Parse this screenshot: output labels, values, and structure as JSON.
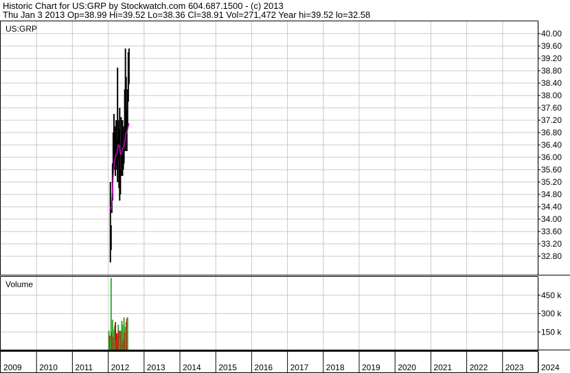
{
  "header": {
    "title": "Historic Chart for US:GRP by Stockwatch.com 604.687.1500 - (c) 2013",
    "quote": "Thu Jan  3 2013  Op=38.99  Hi=39.52  Lo=38.36  Cl=38.91  Vol=271,472  Year hi=39.52  lo=32.58"
  },
  "chart_data": [
    {
      "type": "candlestick",
      "title": "US:GRP",
      "price_ticks": [
        "40.00",
        "39.60",
        "39.20",
        "38.80",
        "38.40",
        "38.00",
        "37.60",
        "37.20",
        "36.80",
        "36.40",
        "36.00",
        "35.60",
        "35.20",
        "34.80",
        "34.40",
        "34.00",
        "33.60",
        "33.20",
        "32.80"
      ],
      "ylim": [
        32.2,
        40.4
      ],
      "x_ticks": [
        "2009",
        "2010",
        "2011",
        "2012",
        "2013",
        "2014",
        "2015",
        "2016",
        "2017",
        "2018",
        "2019",
        "2020",
        "2021",
        "2022",
        "2023",
        "2024"
      ],
      "grid": true,
      "moving_average_color": "#cc00cc",
      "bar_color": "#000000",
      "x": [
        2012.06,
        2012.08,
        2012.1,
        2012.12,
        2012.14,
        2012.16,
        2012.18,
        2012.2,
        2012.22,
        2012.24,
        2012.26,
        2012.28,
        2012.3,
        2012.32,
        2012.34,
        2012.36,
        2012.38,
        2012.4,
        2012.42,
        2012.44,
        2012.46,
        2012.48,
        2012.5,
        2012.52,
        2012.54,
        2012.56,
        2012.58
      ],
      "high": [
        35.2,
        33.8,
        34.6,
        35.8,
        36.8,
        37.4,
        37.0,
        36.8,
        37.2,
        36.6,
        38.9,
        37.2,
        36.9,
        37.6,
        35.6,
        37.3,
        36.8,
        37.2,
        36.4,
        37.0,
        38.2,
        39.52,
        38.6,
        37.5,
        38.2,
        39.4,
        39.52
      ],
      "low": [
        32.6,
        33.0,
        34.2,
        34.6,
        35.6,
        35.8,
        35.6,
        35.4,
        35.8,
        35.6,
        35.2,
        35.9,
        35.0,
        34.6,
        34.8,
        35.4,
        35.8,
        35.4,
        35.6,
        35.8,
        36.4,
        36.2,
        36.6,
        36.2,
        37.0,
        37.8,
        38.36
      ],
      "ma": [
        34.4,
        34.3,
        34.6,
        35.0,
        35.4,
        35.7,
        35.9,
        36.0,
        36.1,
        36.1,
        36.3,
        36.4,
        36.4,
        36.3,
        36.1,
        36.1,
        36.2,
        36.3,
        36.3,
        36.4,
        36.5,
        36.7,
        36.8,
        36.8,
        36.9,
        37.0,
        37.1
      ]
    },
    {
      "type": "bar",
      "title": "Volume",
      "volume_ticks": [
        "450 k",
        "300 k",
        "150 k"
      ],
      "ylim": [
        0,
        600
      ],
      "up_color": "#33aa33",
      "down_color": "#dd0000",
      "x": [
        2012.02,
        2012.04,
        2012.06,
        2012.08,
        2012.1,
        2012.12,
        2012.14,
        2012.16,
        2012.18,
        2012.2,
        2012.22,
        2012.24,
        2012.26,
        2012.28,
        2012.3,
        2012.32,
        2012.34,
        2012.36,
        2012.38,
        2012.4,
        2012.42,
        2012.44,
        2012.46,
        2012.48,
        2012.5,
        2012.52,
        2012.54
      ],
      "volume": [
        160,
        120,
        90,
        590,
        150,
        250,
        110,
        170,
        200,
        230,
        90,
        140,
        120,
        210,
        160,
        100,
        160,
        160,
        240,
        210,
        80,
        270,
        150,
        190,
        230,
        260,
        271.472
      ],
      "direction": [
        "up",
        "down",
        "up",
        "up",
        "down",
        "up",
        "down",
        "up",
        "up",
        "down",
        "up",
        "down",
        "down",
        "up",
        "down",
        "up",
        "up",
        "down",
        "up",
        "up",
        "down",
        "up",
        "down",
        "up",
        "up",
        "down",
        "up"
      ]
    }
  ]
}
